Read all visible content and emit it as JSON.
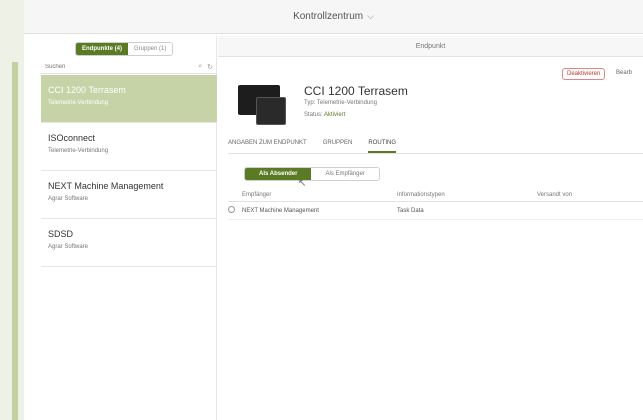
{
  "window": {
    "title": "Kontrollzentrum"
  },
  "sidebar": {
    "segment": [
      {
        "label": "Endpunkte (4)",
        "active": true
      },
      {
        "label": "Gruppen (1)",
        "active": false
      }
    ],
    "search_placeholder": "Suchen",
    "items": [
      {
        "name": "CCI 1200 Terrasem",
        "sub": "Telemetrie-Verbindung",
        "selected": true
      },
      {
        "name": "ISOconnect",
        "sub": "Telemetrie-Verbindung",
        "selected": false
      },
      {
        "name": "NEXT Machine Management",
        "sub": "Agrar Software",
        "selected": false
      },
      {
        "name": "SDSD",
        "sub": "Agrar Software",
        "selected": false
      }
    ]
  },
  "detail": {
    "header": "Endpunkt",
    "deactivate_label": "Deaktivieren",
    "edit_label": "Bearb",
    "device_name": "CCI 1200 Terrasem",
    "type_line": "Typ: Telemetrie-Verbindung",
    "status_label": "Status:",
    "status_value": "Aktiviert",
    "tabs": [
      {
        "label": "ANGABEN ZUM ENDPUNKT",
        "active": false
      },
      {
        "label": "GRUPPEN",
        "active": false
      },
      {
        "label": "ROUTING",
        "active": true
      }
    ],
    "routing_segment": [
      {
        "label": "Als Absender",
        "active": true
      },
      {
        "label": "Als Empfänger",
        "active": false
      }
    ],
    "table": {
      "headers": [
        "Empfänger",
        "Informationstypen",
        "Versandt von"
      ],
      "rows": [
        {
          "receiver": "NEXT Machine Management",
          "info": "Task Data",
          "sent": ""
        }
      ]
    }
  },
  "colors": {
    "accent": "#5b7a26",
    "selected_bg": "#c6d3a7",
    "danger": "#c0392b"
  }
}
